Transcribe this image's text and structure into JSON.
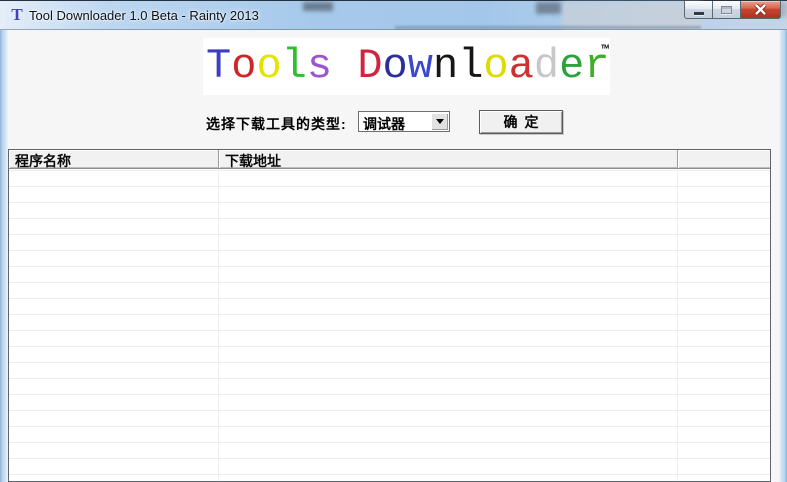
{
  "window": {
    "title": "Tool Downloader 1.0 Beta - Rainty 2013",
    "icon_glyph": "T"
  },
  "heading": {
    "letters": [
      {
        "ch": "T",
        "color": "#3b3fc3"
      },
      {
        "ch": "o",
        "color": "#cf2727"
      },
      {
        "ch": "o",
        "color": "#e4e400"
      },
      {
        "ch": "l",
        "color": "#2dbf2d"
      },
      {
        "ch": "s",
        "color": "#9a55cf"
      },
      {
        "ch": " ",
        "color": "#000000"
      },
      {
        "ch": "D",
        "color": "#d02540"
      },
      {
        "ch": "o",
        "color": "#2a2f9c"
      },
      {
        "ch": "w",
        "color": "#3948cf"
      },
      {
        "ch": "n",
        "color": "#161616"
      },
      {
        "ch": "l",
        "color": "#161616"
      },
      {
        "ch": "o",
        "color": "#dcdc00"
      },
      {
        "ch": "a",
        "color": "#cf3030"
      },
      {
        "ch": "d",
        "color": "#c7c7c7"
      },
      {
        "ch": "e",
        "color": "#2da23c"
      },
      {
        "ch": "r",
        "color": "#3fae28"
      }
    ],
    "trademark": "™"
  },
  "toolbar": {
    "type_label": "选择下载工具的类型:",
    "type_value": "调试器",
    "confirm_label": "确定"
  },
  "list": {
    "columns": [
      "程序名称",
      "下载地址",
      ""
    ],
    "rows": []
  },
  "colors": {
    "titlebar_glass": "#a6c9eb",
    "close_button_red": "#c64430",
    "client_bg": "#f6f6f6",
    "header_bg": "#f1f1f1"
  }
}
